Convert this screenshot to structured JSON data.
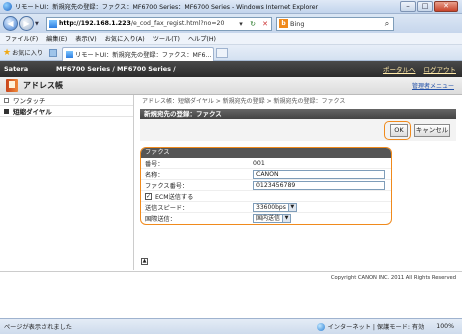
{
  "window": {
    "title": "リモートUI：新規宛先の登録：ファクス：MF6700 Series：MF6700 Series - Windows Internet Explorer",
    "minimize": "–",
    "maximize": "□",
    "close": "✕"
  },
  "nav": {
    "back": "◀",
    "forward": "▶",
    "url_host": "http://192.168.1.223",
    "url_path": "/e_cod_fax_regist.html?no=20",
    "search_label": "Bing"
  },
  "menu": [
    "ファイル(F)",
    "編集(E)",
    "表示(V)",
    "お気に入り(A)",
    "ツール(T)",
    "ヘルプ(H)"
  ],
  "tabs": {
    "favorites": "お気に入り",
    "active_tab": "リモートUI：新規宛先の登録：ファクス：MF6..."
  },
  "header": {
    "brand": "Satera",
    "model": "MF6700 Series / MF6700 Series /",
    "portal": "ポータルへ",
    "logout": "ログアウト"
  },
  "app": {
    "title": "アドレス帳",
    "manual_link": "管理者メニュー"
  },
  "sidebar": {
    "items": [
      {
        "label": "ワンタッチ"
      },
      {
        "label": "短縮ダイヤル"
      }
    ]
  },
  "main": {
    "breadcrumb": "アドレス帳：短縮ダイヤル > 新規宛先の登録 > 新規宛先の登録：ファクス",
    "section_title": "新規宛先の登録：ファクス",
    "ok_label": "OK",
    "cancel_label": "キャンセル",
    "sub_title": "ファクス",
    "fields": {
      "number_label": "番号：",
      "number_value": "001",
      "name_label": "名称：",
      "name_value": "CANON",
      "fax_label": "ファクス番号：",
      "fax_value": "0123456789",
      "ecm_label": "ECM送信する",
      "speed_label": "送信スピード：",
      "speed_value": "33600bps",
      "intl_label": "国際送信：",
      "intl_value": "国内送信"
    }
  },
  "footer": {
    "copyright": "Copyright CANON INC. 2011 All Rights Reserved"
  },
  "statusbar": {
    "status": "ページが表示されました",
    "zone": "インターネット | 保護モード: 有効",
    "zoom": "100%"
  }
}
